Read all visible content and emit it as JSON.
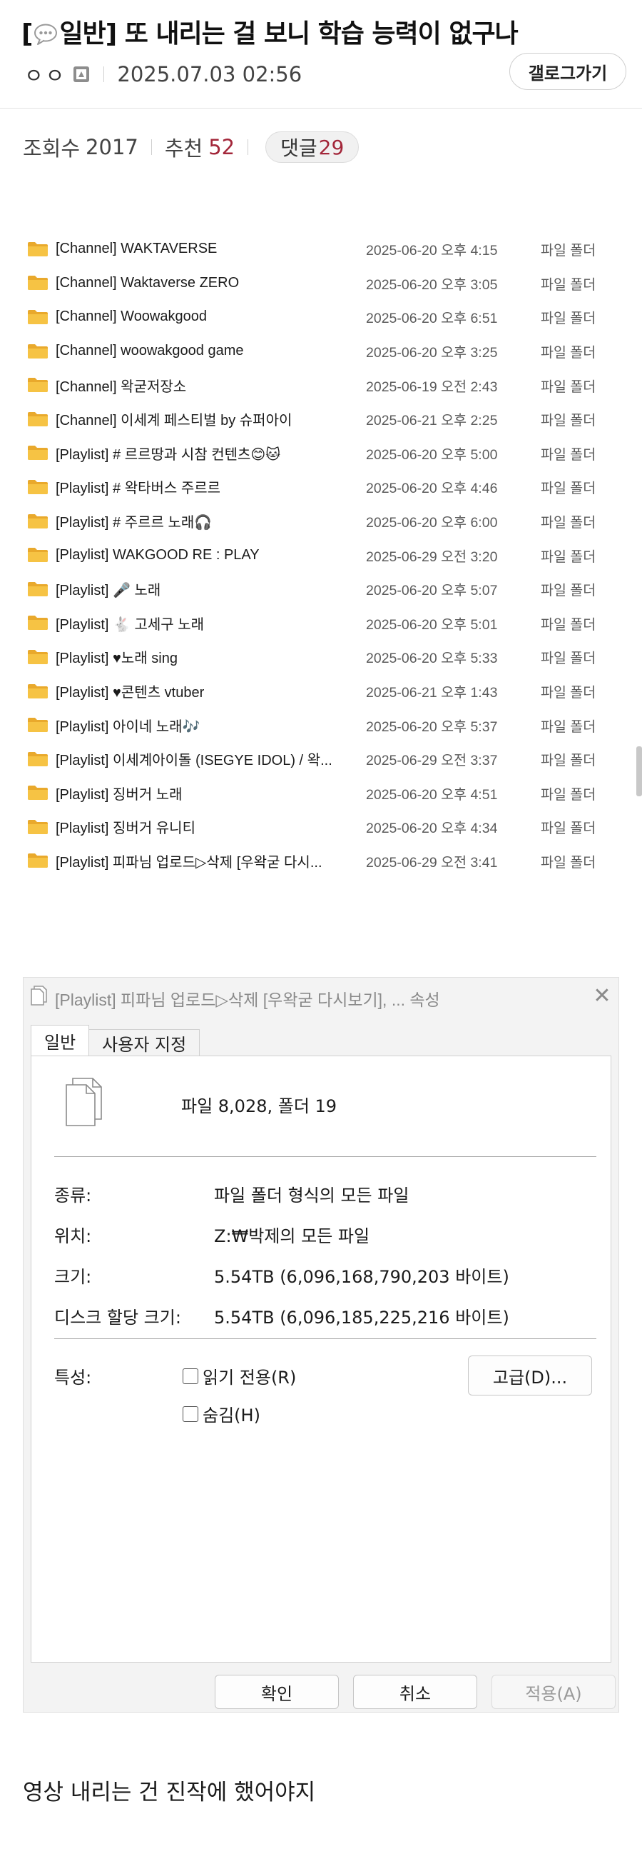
{
  "post": {
    "title_prefix": "[",
    "title_category": "일반]",
    "title_text": " 또 내리는 걸 보니 학습 능력이 없구나",
    "author": "ㅇㅇ",
    "date": "2025.07.03 02:56",
    "gallery_button": "갤로그가기",
    "views_label": "조회수",
    "views": "2017",
    "recommend_label": "추천",
    "recommend": "52",
    "comments_label": "댓글",
    "comments": "29",
    "body": "영상 내리는 건 진작에 했어야지"
  },
  "folders": [
    {
      "name": "[Channel] WAKTAVERSE",
      "date": "2025-06-20 오후 4:15",
      "type": "파일 폴더"
    },
    {
      "name": "[Channel] Waktaverse ZERO",
      "date": "2025-06-20 오후 3:05",
      "type": "파일 폴더"
    },
    {
      "name": "[Channel] Woowakgood",
      "date": "2025-06-20 오후 6:51",
      "type": "파일 폴더"
    },
    {
      "name": "[Channel] woowakgood game",
      "date": "2025-06-20 오후 3:25",
      "type": "파일 폴더"
    },
    {
      "name": "[Channel] 왁굳저장소",
      "date": "2025-06-19 오전 2:43",
      "type": "파일 폴더"
    },
    {
      "name": "[Channel] 이세계 페스티벌 by 슈퍼아이",
      "date": "2025-06-21 오후 2:25",
      "type": "파일 폴더"
    },
    {
      "name": "[Playlist] # 르르땅과 시참 컨텐츠😊🐱",
      "date": "2025-06-20 오후 5:00",
      "type": "파일 폴더"
    },
    {
      "name": "[Playlist] # 왁타버스 주르르",
      "date": "2025-06-20 오후 4:46",
      "type": "파일 폴더"
    },
    {
      "name": "[Playlist] # 주르르 노래🎧",
      "date": "2025-06-20 오후 6:00",
      "type": "파일 폴더"
    },
    {
      "name": "[Playlist] WAKGOOD RE : PLAY",
      "date": "2025-06-29 오전 3:20",
      "type": "파일 폴더"
    },
    {
      "name": "[Playlist] 🎤 노래",
      "date": "2025-06-20 오후 5:07",
      "type": "파일 폴더"
    },
    {
      "name": "[Playlist] 🐇 고세구 노래",
      "date": "2025-06-20 오후 5:01",
      "type": "파일 폴더"
    },
    {
      "name": "[Playlist] ♥노래 sing",
      "date": "2025-06-20 오후 5:33",
      "type": "파일 폴더"
    },
    {
      "name": "[Playlist] ♥콘텐츠 vtuber",
      "date": "2025-06-21 오후 1:43",
      "type": "파일 폴더"
    },
    {
      "name": "[Playlist] 아이네 노래🎶",
      "date": "2025-06-20 오후 5:37",
      "type": "파일 폴더"
    },
    {
      "name": "[Playlist] 이세계아이돌 (ISEGYE IDOL) / 왁...",
      "date": "2025-06-29 오전 3:37",
      "type": "파일 폴더"
    },
    {
      "name": "[Playlist] 징버거 노래",
      "date": "2025-06-20 오후 4:51",
      "type": "파일 폴더"
    },
    {
      "name": "[Playlist] 징버거 유니티",
      "date": "2025-06-20 오후 4:34",
      "type": "파일 폴더"
    },
    {
      "name": "[Playlist] 피파님 업로드▷삭제 [우왁굳 다시...",
      "date": "2025-06-29 오전 3:41",
      "type": "파일 폴더"
    }
  ],
  "dialog": {
    "title": "[Playlist] 피파님 업로드▷삭제 [우왁굳 다시보기], ... 속성",
    "tabs": [
      "일반",
      "사용자 지정"
    ],
    "file_count": "파일 8,028, 폴더 19",
    "type_label": "종류:",
    "type_value": "파일 폴더 형식의 모든 파일",
    "location_label": "위치:",
    "location_value": "Z:₩박제의 모든 파일",
    "size_label": "크기:",
    "size_value": "5.54TB (6,096,168,790,203 바이트)",
    "disk_size_label": "디스크 할당 크기:",
    "disk_size_value": "5.54TB (6,096,185,225,216 바이트)",
    "attributes_label": "특성:",
    "readonly_label": "읽기 전용(R)",
    "hidden_label": "숨김(H)",
    "advanced_button": "고급(D)...",
    "ok_button": "확인",
    "cancel_button": "취소",
    "apply_button": "적용(A)"
  },
  "colors": {
    "accent_red": "#a3273a",
    "folder_yellow": "#f6c344"
  }
}
